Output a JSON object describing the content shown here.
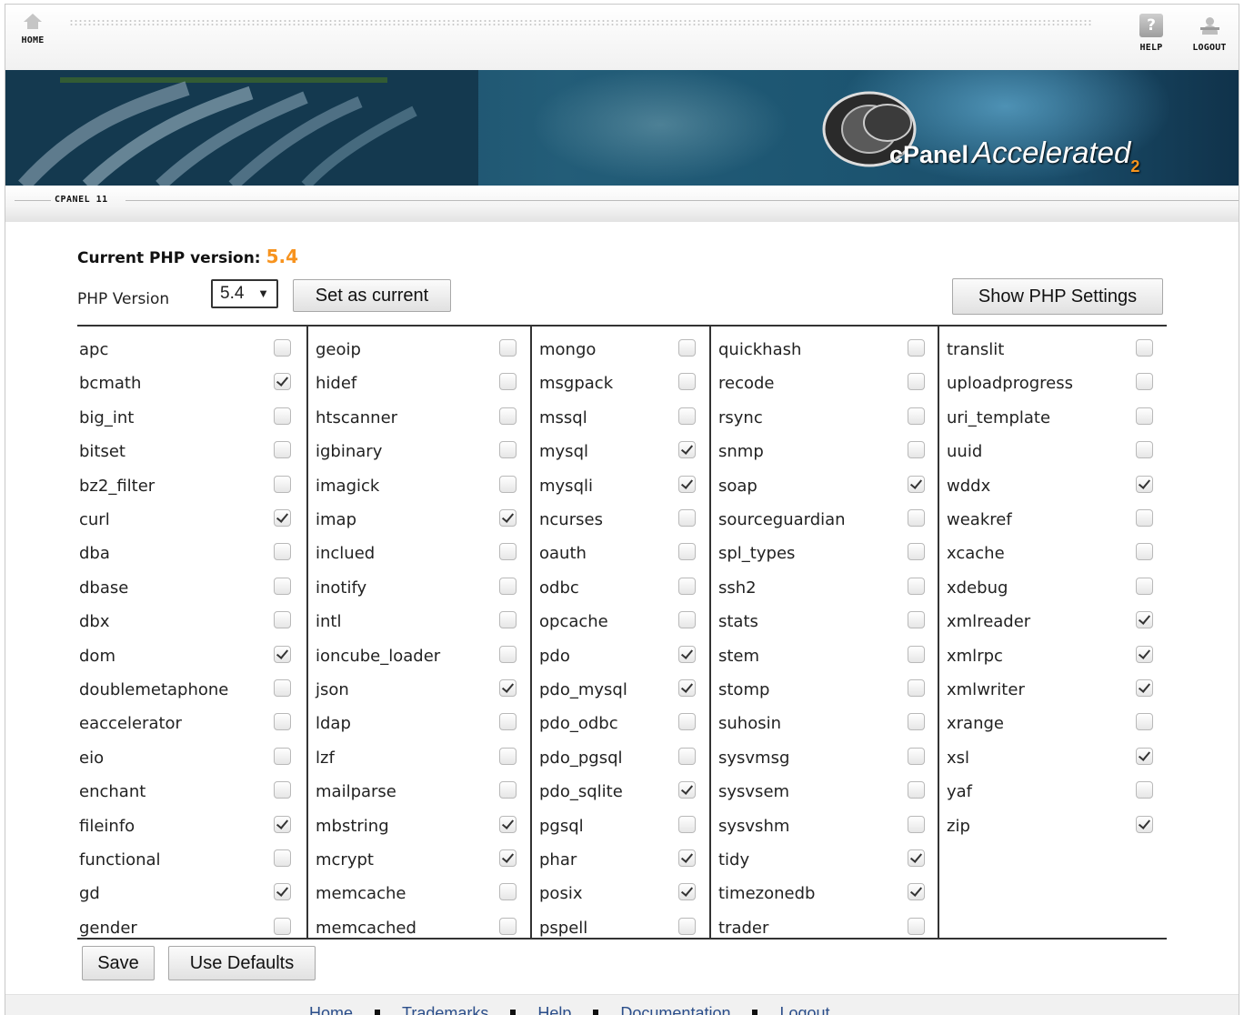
{
  "nav": {
    "home_label": "HOME",
    "help_label": "HELP",
    "logout_label": "LOGOUT",
    "help_glyph": "?"
  },
  "banner": {
    "brand": "cPanel",
    "tagline": "Accelerated",
    "tagline_sub": "2",
    "brand_color": "#f7941d"
  },
  "section": {
    "label": "CPANEL 11"
  },
  "php": {
    "current_label": "Current PHP version:",
    "current_value": "5.4",
    "version_label": "PHP Version",
    "selected_version": "5.4",
    "dropdown_arrow": "▼",
    "set_current_label": "Set as current",
    "show_settings_label": "Show PHP Settings",
    "accent_color": "#f7931e"
  },
  "extensions": [
    [
      {
        "name": "apc",
        "checked": false
      },
      {
        "name": "bcmath",
        "checked": true
      },
      {
        "name": "big_int",
        "checked": false
      },
      {
        "name": "bitset",
        "checked": false
      },
      {
        "name": "bz2_filter",
        "checked": false
      },
      {
        "name": "curl",
        "checked": true
      },
      {
        "name": "dba",
        "checked": false
      },
      {
        "name": "dbase",
        "checked": false
      },
      {
        "name": "dbx",
        "checked": false
      },
      {
        "name": "dom",
        "checked": true
      },
      {
        "name": "doublemetaphone",
        "checked": false
      },
      {
        "name": "eaccelerator",
        "checked": false
      },
      {
        "name": "eio",
        "checked": false
      },
      {
        "name": "enchant",
        "checked": false
      },
      {
        "name": "fileinfo",
        "checked": true
      },
      {
        "name": "functional",
        "checked": false
      },
      {
        "name": "gd",
        "checked": true
      },
      {
        "name": "gender",
        "checked": false
      }
    ],
    [
      {
        "name": "geoip",
        "checked": false
      },
      {
        "name": "hidef",
        "checked": false
      },
      {
        "name": "htscanner",
        "checked": false
      },
      {
        "name": "igbinary",
        "checked": false
      },
      {
        "name": "imagick",
        "checked": false
      },
      {
        "name": "imap",
        "checked": true
      },
      {
        "name": "inclued",
        "checked": false
      },
      {
        "name": "inotify",
        "checked": false
      },
      {
        "name": "intl",
        "checked": false
      },
      {
        "name": "ioncube_loader",
        "checked": false
      },
      {
        "name": "json",
        "checked": true
      },
      {
        "name": "ldap",
        "checked": false
      },
      {
        "name": "lzf",
        "checked": false
      },
      {
        "name": "mailparse",
        "checked": false
      },
      {
        "name": "mbstring",
        "checked": true
      },
      {
        "name": "mcrypt",
        "checked": true
      },
      {
        "name": "memcache",
        "checked": false
      },
      {
        "name": "memcached",
        "checked": false
      }
    ],
    [
      {
        "name": "mongo",
        "checked": false
      },
      {
        "name": "msgpack",
        "checked": false
      },
      {
        "name": "mssql",
        "checked": false
      },
      {
        "name": "mysql",
        "checked": true
      },
      {
        "name": "mysqli",
        "checked": true
      },
      {
        "name": "ncurses",
        "checked": false
      },
      {
        "name": "oauth",
        "checked": false
      },
      {
        "name": "odbc",
        "checked": false
      },
      {
        "name": "opcache",
        "checked": false
      },
      {
        "name": "pdo",
        "checked": true
      },
      {
        "name": "pdo_mysql",
        "checked": true
      },
      {
        "name": "pdo_odbc",
        "checked": false
      },
      {
        "name": "pdo_pgsql",
        "checked": false
      },
      {
        "name": "pdo_sqlite",
        "checked": true
      },
      {
        "name": "pgsql",
        "checked": false
      },
      {
        "name": "phar",
        "checked": true
      },
      {
        "name": "posix",
        "checked": true
      },
      {
        "name": "pspell",
        "checked": false
      }
    ],
    [
      {
        "name": "quickhash",
        "checked": false
      },
      {
        "name": "recode",
        "checked": false
      },
      {
        "name": "rsync",
        "checked": false
      },
      {
        "name": "snmp",
        "checked": false
      },
      {
        "name": "soap",
        "checked": true
      },
      {
        "name": "sourceguardian",
        "checked": false
      },
      {
        "name": "spl_types",
        "checked": false
      },
      {
        "name": "ssh2",
        "checked": false
      },
      {
        "name": "stats",
        "checked": false
      },
      {
        "name": "stem",
        "checked": false
      },
      {
        "name": "stomp",
        "checked": false
      },
      {
        "name": "suhosin",
        "checked": false
      },
      {
        "name": "sysvmsg",
        "checked": false
      },
      {
        "name": "sysvsem",
        "checked": false
      },
      {
        "name": "sysvshm",
        "checked": false
      },
      {
        "name": "tidy",
        "checked": true
      },
      {
        "name": "timezonedb",
        "checked": true
      },
      {
        "name": "trader",
        "checked": false
      }
    ],
    [
      {
        "name": "translit",
        "checked": false
      },
      {
        "name": "uploadprogress",
        "checked": false
      },
      {
        "name": "uri_template",
        "checked": false
      },
      {
        "name": "uuid",
        "checked": false
      },
      {
        "name": "wddx",
        "checked": true
      },
      {
        "name": "weakref",
        "checked": false
      },
      {
        "name": "xcache",
        "checked": false
      },
      {
        "name": "xdebug",
        "checked": false
      },
      {
        "name": "xmlreader",
        "checked": true
      },
      {
        "name": "xmlrpc",
        "checked": true
      },
      {
        "name": "xmlwriter",
        "checked": true
      },
      {
        "name": "xrange",
        "checked": false
      },
      {
        "name": "xsl",
        "checked": true
      },
      {
        "name": "yaf",
        "checked": false
      },
      {
        "name": "zip",
        "checked": true
      }
    ]
  ],
  "actions": {
    "save_label": "Save",
    "defaults_label": "Use Defaults"
  },
  "footer": {
    "links": [
      "Home",
      "Trademarks",
      "Help",
      "Documentation",
      "Logout"
    ]
  }
}
